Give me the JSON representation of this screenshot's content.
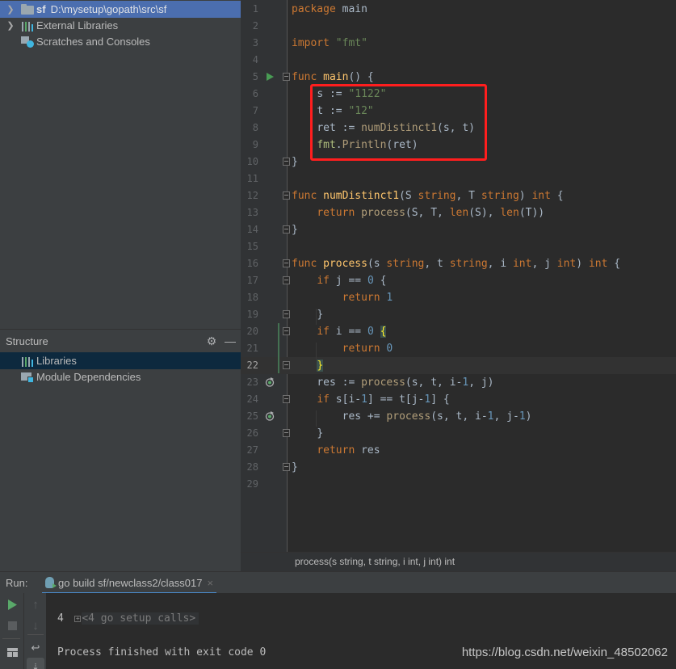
{
  "project_tree": {
    "items": [
      {
        "label_bold": "sf",
        "label": "D:\\mysetup\\gopath\\src\\sf",
        "icon": "folder-icon",
        "expandable": true,
        "selected": true
      },
      {
        "label": "External Libraries",
        "icon": "libraries-icon",
        "expandable": true
      },
      {
        "label": "Scratches and Consoles",
        "icon": "scratches-icon",
        "expandable": false
      }
    ]
  },
  "structure": {
    "title": "Structure",
    "settings_icon": "gear-icon",
    "hide_icon": "minus-icon",
    "items": [
      {
        "label": "Libraries",
        "icon": "libraries-icon",
        "selected": true
      },
      {
        "label": "Module Dependencies",
        "icon": "module-dependencies-icon"
      }
    ]
  },
  "editor": {
    "current_line": 22,
    "lines": [
      {
        "n": "1"
      },
      {
        "n": "2"
      },
      {
        "n": "3"
      },
      {
        "n": "4"
      },
      {
        "n": "5"
      },
      {
        "n": "6"
      },
      {
        "n": "7"
      },
      {
        "n": "8"
      },
      {
        "n": "9"
      },
      {
        "n": "10"
      },
      {
        "n": "11"
      },
      {
        "n": "12"
      },
      {
        "n": "13"
      },
      {
        "n": "14"
      },
      {
        "n": "15"
      },
      {
        "n": "16"
      },
      {
        "n": "17"
      },
      {
        "n": "18"
      },
      {
        "n": "19"
      },
      {
        "n": "20"
      },
      {
        "n": "21"
      },
      {
        "n": "22"
      },
      {
        "n": "23"
      },
      {
        "n": "24"
      },
      {
        "n": "25"
      },
      {
        "n": "26"
      },
      {
        "n": "27"
      },
      {
        "n": "28"
      },
      {
        "n": "29"
      }
    ],
    "tokens": {
      "l1": [
        "package",
        " main"
      ],
      "l3": [
        "import",
        " ",
        "\"fmt\""
      ],
      "l5": [
        "func",
        " ",
        "main",
        "() {"
      ],
      "l6": [
        "s := ",
        "\"1122\""
      ],
      "l7": [
        "t := ",
        "\"12\""
      ],
      "l8": [
        "ret := ",
        "numDistinct1",
        "(s, t)"
      ],
      "l9": [
        "fmt",
        ".",
        "Println",
        "(ret)"
      ],
      "l10": [
        "}"
      ],
      "l12": [
        "func",
        " ",
        "numDistinct1",
        "(S ",
        "string",
        ", T ",
        "string",
        ") ",
        "int",
        " {"
      ],
      "l13": [
        "return",
        " ",
        "process",
        "(S, T, ",
        "len",
        "(S), ",
        "len",
        "(T))"
      ],
      "l14": [
        "}"
      ],
      "l16": [
        "func",
        " ",
        "process",
        "(s ",
        "string",
        ", t ",
        "string",
        ", i ",
        "int",
        ", j ",
        "int",
        ") ",
        "int",
        " {"
      ],
      "l17": [
        "if",
        " j == ",
        "0",
        " {"
      ],
      "l18": [
        "return",
        " ",
        "1"
      ],
      "l19": [
        "}"
      ],
      "l20": [
        "if",
        " i == ",
        "0",
        " ",
        "{"
      ],
      "l21": [
        "return",
        " ",
        "0"
      ],
      "l22": [
        "}"
      ],
      "l23": [
        "res := ",
        "process",
        "(s, t, i-",
        "1",
        ", j)"
      ],
      "l24": [
        "if",
        " s[i-",
        "1",
        "] == t[j-",
        "1",
        "] {"
      ],
      "l25": [
        "res += ",
        "process",
        "(s, t, i-",
        "1",
        ", j-",
        "1",
        ")"
      ],
      "l26": [
        "}"
      ],
      "l27": [
        "return",
        " res"
      ],
      "l28": [
        "}"
      ]
    },
    "gutter_icons": {
      "run_line": 5,
      "recursion_lines": [
        23,
        25
      ]
    }
  },
  "breadcrumb": "process(s string, t string, i int, j int) int",
  "run_panel": {
    "label": "Run:",
    "tab_label": "go build sf/newclass2/class017",
    "tab_close": "×",
    "console": {
      "setup_calls": "<4 go setup calls>",
      "output": "4",
      "exit_message": "Process finished with exit code 0"
    }
  },
  "watermark": "https://blog.csdn.net/weixin_48502062",
  "colors": {
    "selection_blue": "#4b6eaf",
    "highlight_red": "#ff1e1e",
    "keyword": "#cc7832",
    "string": "#6a8759",
    "number": "#6897bb",
    "function": "#ffc66d"
  }
}
